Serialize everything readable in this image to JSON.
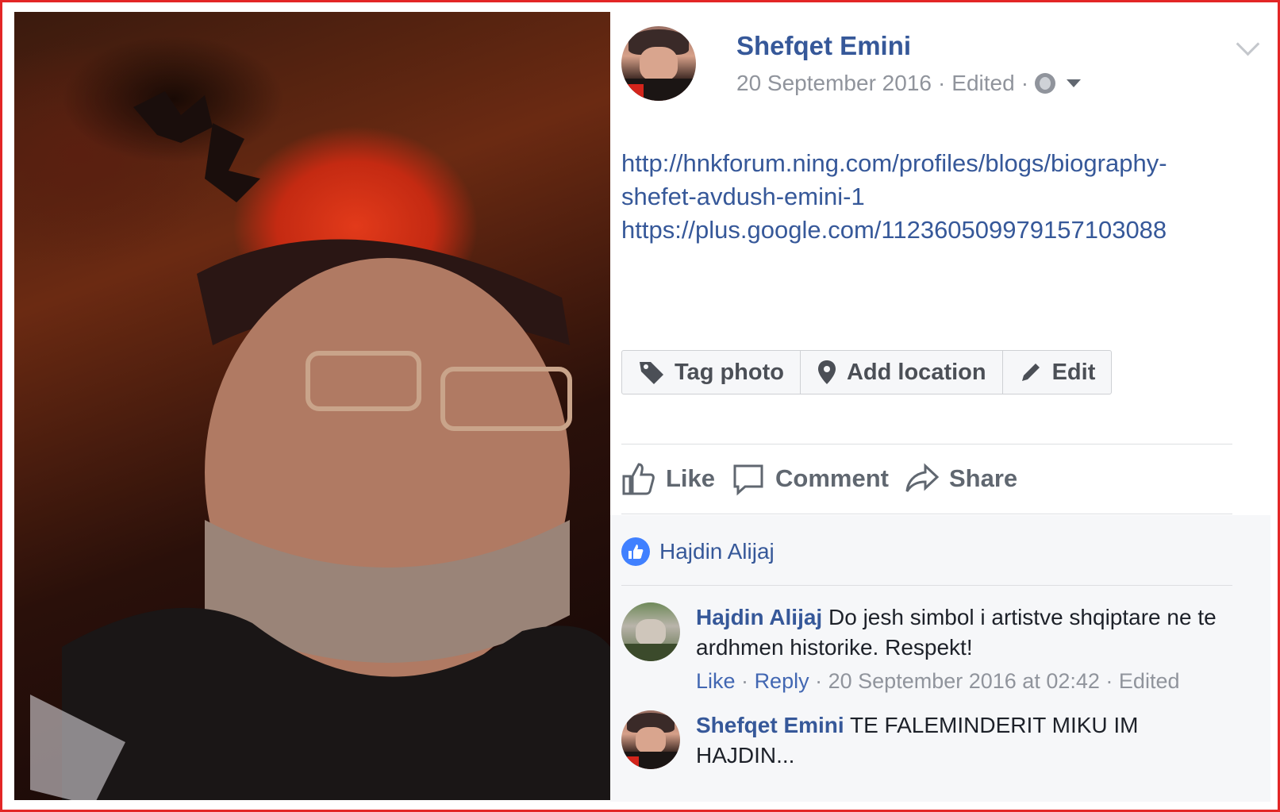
{
  "post": {
    "author": "Shefqet Emini",
    "date": "20 September 2016",
    "edited": "Edited",
    "sep": "·",
    "links": [
      "http://hnkforum.ning.com/profiles/blogs/biography-",
      "shefet-avdush-emini-1",
      "https://plus.google.com/112360509979157103088"
    ]
  },
  "toolbar": {
    "tag_photo": "Tag photo",
    "add_location": "Add location",
    "edit": "Edit"
  },
  "actions": {
    "like": "Like",
    "comment": "Comment",
    "share": "Share"
  },
  "reactions": {
    "liker": "Hajdin Alijaj"
  },
  "comments": [
    {
      "author": "Hajdin Alijaj",
      "text": "Do jesh simbol i artistve shqiptare ne te ardhmen historike. Respekt!",
      "like": "Like",
      "reply": "Reply",
      "time": "20 September 2016 at 02:42",
      "edited": "Edited"
    },
    {
      "author": "Shefqet Emini",
      "text": "TE FALEMINDERIT MIKU IM HAJDIN..."
    }
  ],
  "colors": {
    "link": "#365899",
    "meta": "#90949c",
    "border_red": "#e32626"
  }
}
